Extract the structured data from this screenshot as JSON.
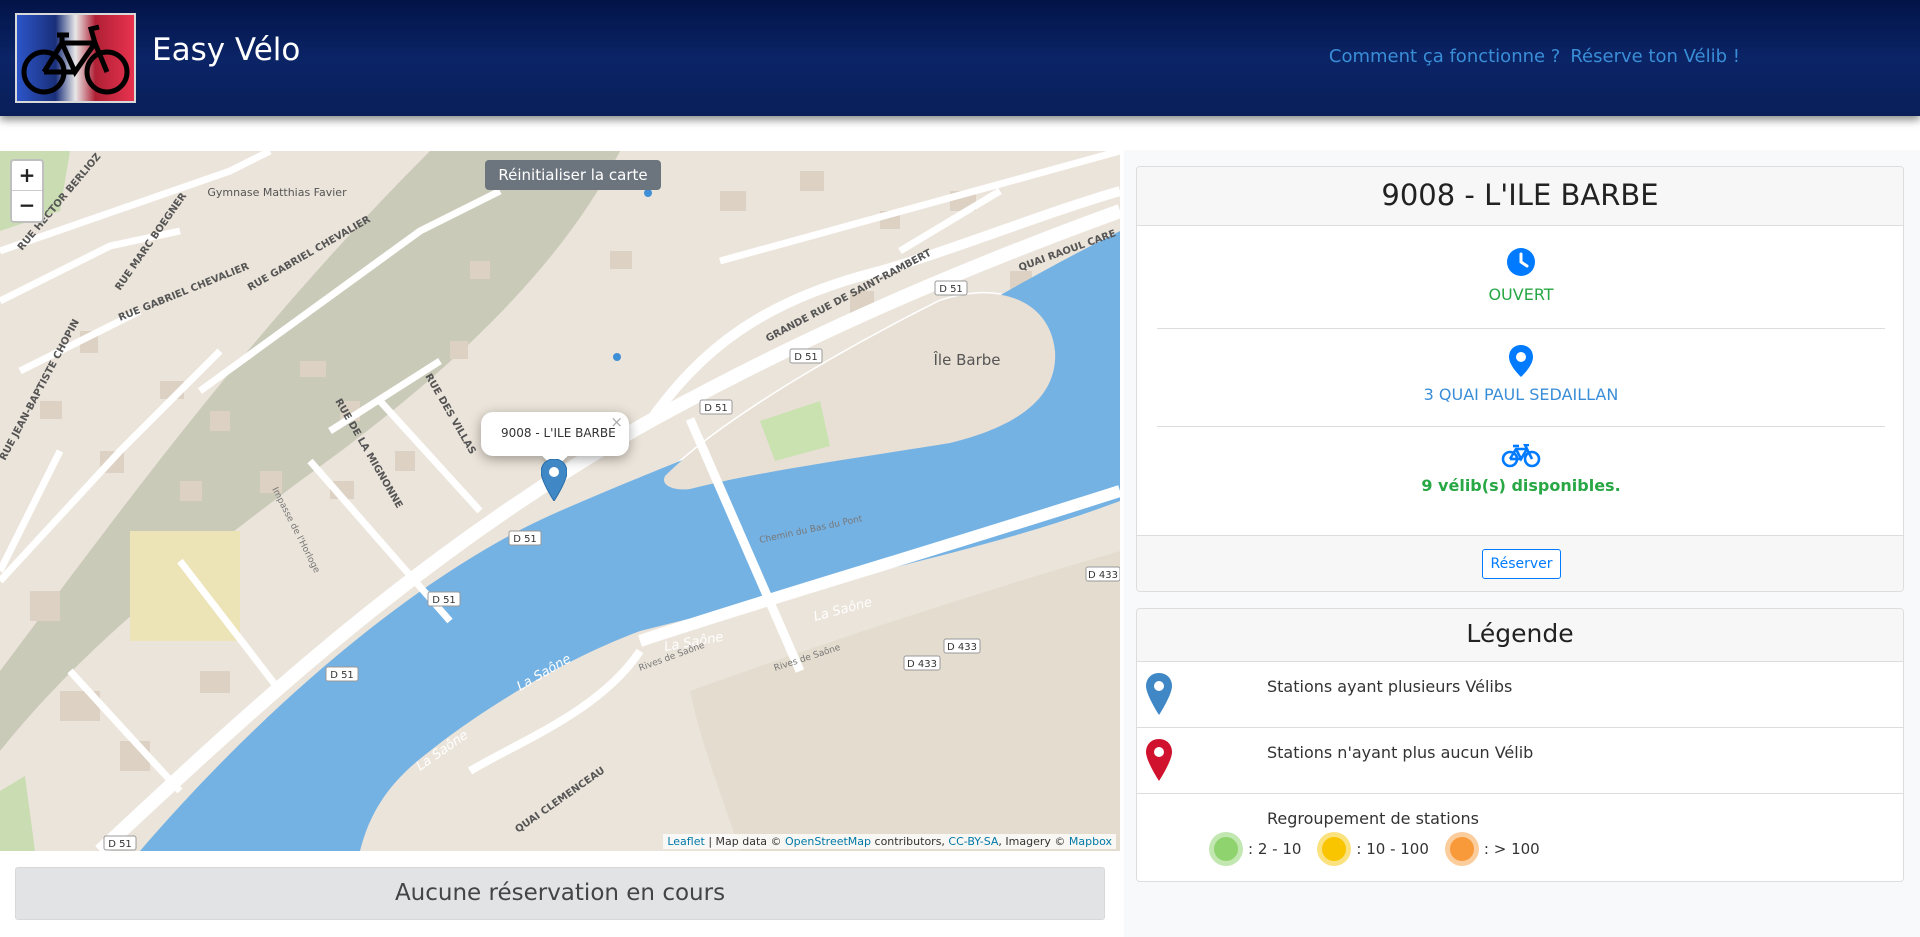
{
  "header": {
    "brand": "Easy Vélo",
    "nav": [
      "Comment ça fonctionne ?",
      "Réserve ton Vélib !"
    ]
  },
  "map": {
    "zoom_in": "+",
    "zoom_out": "−",
    "reset_label": "Réinitialiser la carte",
    "popup_text": "9008 - L'ILE BARBE",
    "popup_close": "×",
    "labels": {
      "gymnase": "Gymnase Matthias Favier",
      "ile_barbe": "Île Barbe",
      "chemin": "Chemin du Bas du Pont",
      "saone": "La Saône",
      "rue_hector": "RUE HECTOR BERLIOZ",
      "rue_marc": "RUE MARC BOEGNER",
      "rue_gabriel": "RUE GABRIEL CHEVALIER",
      "rue_jb": "RUE JEAN-BAPTISTE CHOPIN",
      "rue_villas": "RUE DES VILLAS",
      "rue_mignonne": "RUE DE LA MIGNONNE",
      "impasse": "Impasse de l'Horloge",
      "grande_rue": "GRANDE RUE DE SAINT-RAMBERT",
      "quai_raoul": "QUAI RAOUL CARE",
      "quai_clem": "QUAI CLEMENCEAU",
      "rives": "Rives de Saône",
      "d51": "D 51",
      "d433": "D 433"
    },
    "attribution": {
      "leaflet": "Leaflet",
      "sep": "| Map data ©",
      "osm": "OpenStreetMap",
      "contributors": "contributors,",
      "license": "CC-BY-SA",
      "imagery": ", Imagery ©",
      "mapbox": "Mapbox"
    }
  },
  "reservation_status": "Aucune réservation en cours",
  "station": {
    "title": "9008 - L'ILE BARBE",
    "status": "OUVERT",
    "address": "3 QUAI PAUL SEDAILLAN",
    "bikes": "9 vélib(s) disponibles.",
    "reserve_label": "Réserver"
  },
  "legend": {
    "title": "Légende",
    "rows": [
      "Stations ayant plusieurs Vélibs",
      "Stations n'ayant plus aucun Vélib",
      "Regroupement de stations"
    ],
    "clusters": [
      ": 2 - 10",
      ": 10 - 100",
      ": > 100"
    ]
  },
  "colors": {
    "header_bg": "#0b2466",
    "nav_link": "#3a8ed8",
    "open_green": "#28a745",
    "address_blue": "#3a8ed8",
    "icon_blue": "#007bff",
    "water": "#75b2e4",
    "marker_blue": "#3f88c5",
    "marker_red": "#d1122f",
    "cluster_small": "#8fd36f",
    "cluster_medium": "#f8c500",
    "cluster_large": "#f89a3a"
  }
}
